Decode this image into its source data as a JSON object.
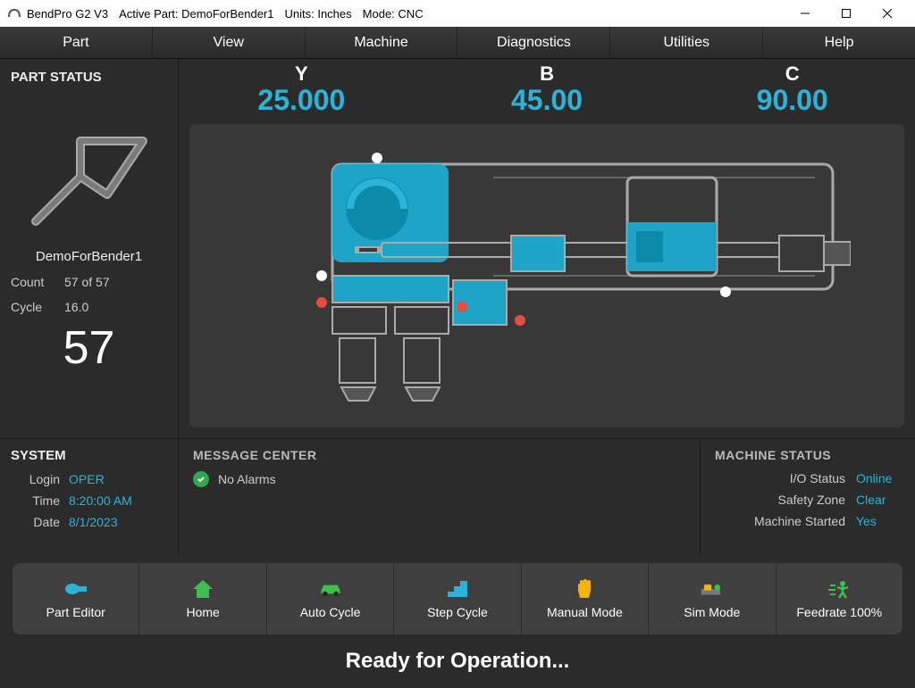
{
  "titlebar": {
    "app": "BendPro G2 V3",
    "active_part_label": "Active Part:",
    "active_part": "DemoForBender1",
    "units_label": "Units:",
    "units": "Inches",
    "mode_label": "Mode:",
    "mode": "CNC"
  },
  "menu": [
    "Part",
    "View",
    "Machine",
    "Diagnostics",
    "Utilities",
    "Help"
  ],
  "part_status": {
    "heading": "PART STATUS",
    "name": "DemoForBender1",
    "count_label": "Count",
    "count_value": "57 of 57",
    "cycle_label": "Cycle",
    "cycle_value": "16.0",
    "big_count": "57"
  },
  "axes": [
    {
      "label": "Y",
      "value": "25.000"
    },
    {
      "label": "B",
      "value": "45.00"
    },
    {
      "label": "C",
      "value": "90.00"
    }
  ],
  "system": {
    "heading": "SYSTEM",
    "login_label": "Login",
    "login": "OPER",
    "time_label": "Time",
    "time": "8:20:00 AM",
    "date_label": "Date",
    "date": "8/1/2023"
  },
  "message_center": {
    "heading": "MESSAGE CENTER",
    "text": "No Alarms"
  },
  "machine_status": {
    "heading": "MACHINE STATUS",
    "rows": [
      {
        "label": "I/O Status",
        "value": "Online"
      },
      {
        "label": "Safety Zone",
        "value": "Clear"
      },
      {
        "label": "Machine Started",
        "value": "Yes"
      }
    ]
  },
  "toolbar": [
    {
      "label": "Part Editor",
      "icon": "part-editor-icon",
      "color": "#2db3d8"
    },
    {
      "label": "Home",
      "icon": "home-icon",
      "color": "#3fbf4f"
    },
    {
      "label": "Auto Cycle",
      "icon": "car-icon",
      "color": "#3fbf4f"
    },
    {
      "label": "Step Cycle",
      "icon": "steps-icon",
      "color": "#2db3d8"
    },
    {
      "label": "Manual Mode",
      "icon": "hand-icon",
      "color": "#f5b400"
    },
    {
      "label": "Sim Mode",
      "icon": "sim-icon",
      "color": "#f5b400"
    },
    {
      "label": "Feedrate 100%",
      "icon": "speed-icon",
      "color": "#3fbf4f"
    }
  ],
  "statusbar": "Ready for Operation..."
}
